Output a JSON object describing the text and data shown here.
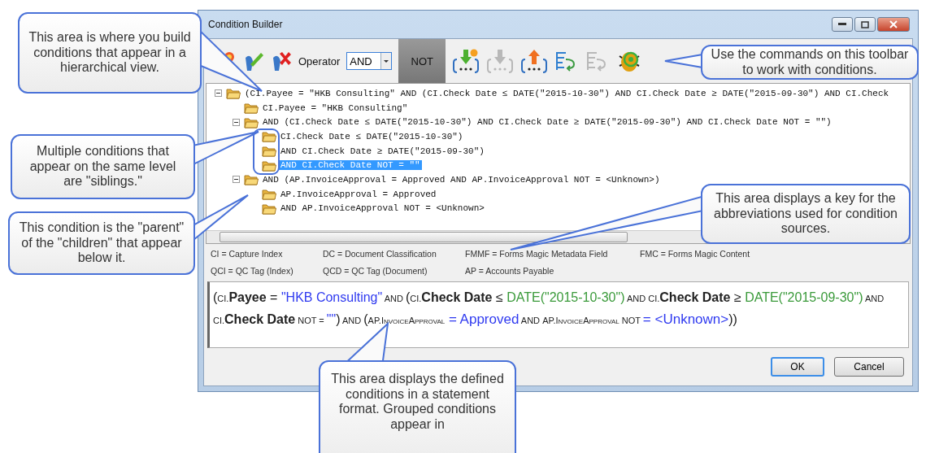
{
  "window": {
    "title": "Condition Builder"
  },
  "toolbar": {
    "items": [
      {
        "kind": "add",
        "disabled": false
      },
      {
        "kind": "edit",
        "disabled": false
      },
      {
        "kind": "remove",
        "disabled": false
      },
      {
        "kind": "label",
        "text": "Operator"
      },
      {
        "kind": "select",
        "value": "AND"
      },
      {
        "kind": "toggle",
        "text": "NOT",
        "selected": true
      },
      {
        "kind": "group-add",
        "disabled": false
      },
      {
        "kind": "group-down",
        "disabled": true
      },
      {
        "kind": "group-up",
        "disabled": false
      },
      {
        "kind": "indent",
        "disabled": false
      },
      {
        "kind": "indent",
        "disabled": true
      },
      {
        "kind": "check",
        "disabled": false
      }
    ]
  },
  "tree": [
    {
      "text": "(CI.Payee = \"HKB Consulting\" AND (CI.Check Date ≤ DATE(\"2015-10-30\") AND CI.Check Date ≥ DATE(\"2015-09-30\") AND CI.Check",
      "expanded": true,
      "selected": false,
      "children": [
        {
          "text": "CI.Payee = \"HKB Consulting\"",
          "selected": false
        },
        {
          "text": "AND (CI.Check Date ≤ DATE(\"2015-10-30\") AND CI.Check Date ≥ DATE(\"2015-09-30\") AND CI.Check Date NOT = \"\")",
          "expanded": true,
          "selected": false,
          "children": [
            {
              "text": "CI.Check Date ≤ DATE(\"2015-10-30\")",
              "selected": false
            },
            {
              "text": "AND CI.Check Date ≥ DATE(\"2015-09-30\")",
              "selected": false
            },
            {
              "text": "AND CI.Check Date NOT = \"\"",
              "selected": true
            }
          ]
        },
        {
          "text": "AND (AP.InvoiceApproval = Approved AND AP.InvoiceApproval NOT = <Unknown>)",
          "expanded": true,
          "selected": false,
          "children": [
            {
              "text": "AP.InvoiceApproval = Approved",
              "selected": false
            },
            {
              "text": "AND AP.InvoiceApproval NOT = <Unknown>",
              "selected": false
            }
          ]
        }
      ]
    }
  ],
  "key": [
    [
      "CI = Capture Index",
      "DC = Document Classification",
      "FMMF = Forms Magic Metadata Field",
      "FMC = Forms Magic Content"
    ],
    [
      "QCI = QC Tag (Index)",
      "QCD = QC Tag (Document)",
      "AP = Accounts Payable"
    ]
  ],
  "statement": [
    {
      "kind": "plain",
      "text": "("
    },
    {
      "kind": "source",
      "text": "CI."
    },
    {
      "kind": "field",
      "text": "Payee"
    },
    {
      "kind": "plain",
      "text": " = "
    },
    {
      "kind": "string",
      "text": "\"HKB Consulting\""
    },
    {
      "kind": "keyword",
      "text": " AND "
    },
    {
      "kind": "plain",
      "text": "("
    },
    {
      "kind": "source",
      "text": "CI."
    },
    {
      "kind": "field",
      "text": "Check Date"
    },
    {
      "kind": "plain",
      "text": " ≤ "
    },
    {
      "kind": "function",
      "text": "DATE(\"2015-10-30\")"
    },
    {
      "kind": "keyword",
      "text": " AND "
    },
    {
      "kind": "source",
      "text": "CI."
    },
    {
      "kind": "field",
      "text": "Check Date"
    },
    {
      "kind": "plain",
      "text": " ≥ "
    },
    {
      "kind": "function",
      "text": "DATE(\"2015-09-30\")"
    },
    {
      "kind": "keyword",
      "text": " AND "
    },
    {
      "kind": "source",
      "text": "CI."
    },
    {
      "kind": "field",
      "text": "Check Date"
    },
    {
      "kind": "keyword",
      "text": " NOT = "
    },
    {
      "kind": "string",
      "text": "\"\""
    },
    {
      "kind": "plain",
      "text": ")"
    },
    {
      "kind": "keyword",
      "text": " AND "
    },
    {
      "kind": "plain",
      "text": "("
    },
    {
      "kind": "source",
      "text": "AP.InvoiceApproval"
    },
    {
      "kind": "value",
      "text": " = Approved"
    },
    {
      "kind": "keyword",
      "text": " AND "
    },
    {
      "kind": "source",
      "text": "AP.InvoiceApproval"
    },
    {
      "kind": "keyword",
      "text": " NOT "
    },
    {
      "kind": "value",
      "text": "= <Unknown>"
    },
    {
      "kind": "plain",
      "text": "))"
    }
  ],
  "buttons": [
    {
      "label": "OK",
      "default": true
    },
    {
      "label": "Cancel",
      "default": false
    }
  ],
  "callouts": [
    {
      "text": "This area is where you build conditions that appear in a hierarchical view."
    },
    {
      "text": "Multiple conditions that appear on the same level are \"siblings.\""
    },
    {
      "text": "This condition is the \"parent\" of the \"children\" that appear below it."
    },
    {
      "text": "Use the commands on this toolbar to work with conditions."
    },
    {
      "text": "This area displays a key for the abbreviations used for condition sources."
    },
    {
      "text": "This area displays the defined conditions in a statement format. Grouped conditions appear in"
    }
  ]
}
